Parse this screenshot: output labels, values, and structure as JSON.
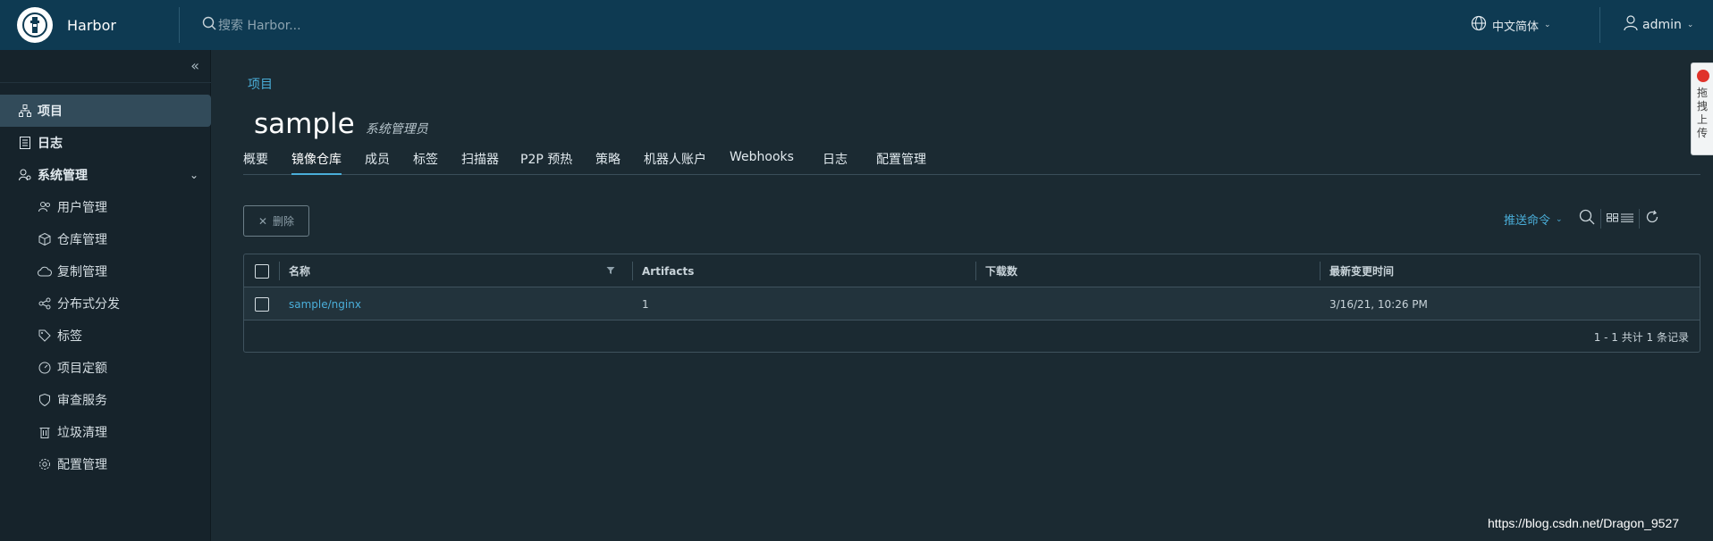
{
  "header": {
    "brand": "Harbor",
    "search_placeholder": "搜索 Harbor...",
    "language": "中文简体",
    "user": "admin"
  },
  "sidebar": {
    "items": [
      {
        "label": "项目",
        "icon": "projects-icon",
        "active": true
      },
      {
        "label": "日志",
        "icon": "log-icon"
      },
      {
        "label": "系统管理",
        "icon": "admin-icon",
        "expanded": true
      }
    ],
    "sub_items": [
      {
        "label": "用户管理",
        "icon": "users-icon"
      },
      {
        "label": "仓库管理",
        "icon": "registry-icon"
      },
      {
        "label": "复制管理",
        "icon": "replication-icon"
      },
      {
        "label": "分布式分发",
        "icon": "distribution-icon"
      },
      {
        "label": "标签",
        "icon": "tag-icon"
      },
      {
        "label": "项目定额",
        "icon": "quota-icon"
      },
      {
        "label": "审查服务",
        "icon": "shield-icon"
      },
      {
        "label": "垃圾清理",
        "icon": "trash-icon"
      },
      {
        "label": "配置管理",
        "icon": "gear-icon"
      }
    ]
  },
  "main": {
    "breadcrumb": "项目",
    "title": "sample",
    "role": "系统管理员",
    "tabs": [
      "概要",
      "镜像仓库",
      "成员",
      "标签",
      "扫描器",
      "P2P 预热",
      "策略",
      "机器人账户",
      "Webhooks",
      "日志",
      "配置管理"
    ],
    "active_tab": "镜像仓库",
    "delete_label": "删除",
    "push_command": "推送命令",
    "table": {
      "headers": [
        "名称",
        "Artifacts",
        "下载数",
        "最新变更时间"
      ],
      "rows": [
        {
          "name": "sample/nginx",
          "artifacts": "1",
          "downloads": "",
          "updated": "3/16/21, 10:26 PM"
        }
      ],
      "footer": "1 - 1 共计 1 条记录"
    }
  },
  "float_widget": {
    "text": "拖拽上传"
  },
  "watermark": "https://blog.csdn.net/Dragon_9527",
  "colors": {
    "header_bg": "#0e3a52",
    "sidebar_bg": "#16232b",
    "main_bg": "#1b2a32",
    "accent": "#4aaed9"
  }
}
